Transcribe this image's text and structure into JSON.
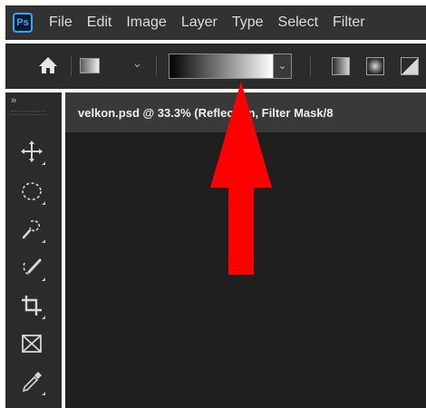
{
  "app": {
    "logo_text": "Ps"
  },
  "menu": {
    "items": [
      "File",
      "Edit",
      "Image",
      "Layer",
      "Type",
      "Select",
      "Filter"
    ]
  },
  "options_bar": {
    "home_icon": "home-icon",
    "preset_icon": "gradient-preset-icon",
    "gradient_preview": {
      "from": "#000000",
      "to": "#ffffff"
    },
    "gradient_types": [
      "linear-gradient-icon",
      "radial-gradient-icon",
      "angle-gradient-icon"
    ]
  },
  "tools": {
    "collapse_label": "››",
    "items": [
      "move-icon",
      "elliptical-marquee-icon",
      "quick-selection-icon",
      "brush-selection-icon",
      "crop-icon",
      "frame-icon",
      "eyedropper-icon"
    ]
  },
  "document": {
    "tab_title": "velkon.psd @ 33.3% (Reflection, Filter Mask/8"
  },
  "annotation": {
    "arrow_color": "#ff0000"
  },
  "colors": {
    "menubar_bg": "#323232",
    "panel_bg": "#2b2b2b",
    "canvas_bg": "#1f1f1f",
    "ps_blue": "#31a8ff"
  }
}
